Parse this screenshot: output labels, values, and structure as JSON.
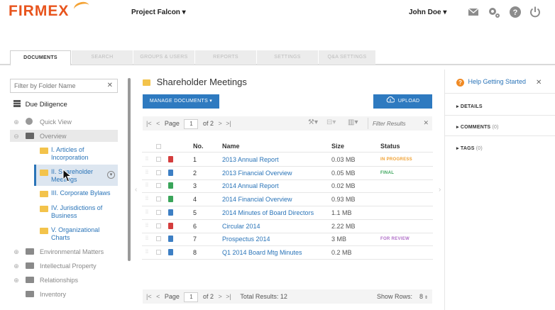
{
  "header": {
    "logo": "FIRMEX",
    "project": "Project Falcon ▾",
    "user": "John Doe ▾"
  },
  "tabs": [
    {
      "label": "DOCUMENTS",
      "active": true
    },
    {
      "label": "SEARCH"
    },
    {
      "label": "GROUPS & USERS"
    },
    {
      "label": "REPORTS"
    },
    {
      "label": "SETTINGS"
    },
    {
      "label": "Q&A SETTINGS"
    }
  ],
  "sidebar": {
    "filter_placeholder": "Filter by Folder Name",
    "root": "Due Diligence",
    "quick_view": "Quick View",
    "overview": "Overview",
    "subfolders": [
      {
        "label": "I. Articles of Incorporation"
      },
      {
        "label": "II. Shareholder Meetings",
        "selected": true
      },
      {
        "label": "III. Corporate Bylaws"
      },
      {
        "label": "IV. Jurisdictions of Business"
      },
      {
        "label": "V. Organizational Charts"
      }
    ],
    "folders": [
      "Environmental Matters",
      "Intellectual Property",
      "Relationships",
      "Inventory"
    ]
  },
  "main": {
    "folder_title": "Shareholder Meetings",
    "manage_label": "MANAGE DOCUMENTS ▾",
    "upload_label": "UPLOAD",
    "page_label": "Page",
    "page_value": "1",
    "page_of": "of 2",
    "filter_placeholder": "Filter Results",
    "total_results": "Total Results: 12",
    "show_rows_label": "Show Rows:",
    "show_rows_value": "8",
    "columns": {
      "no": "No.",
      "name": "Name",
      "size": "Size",
      "status": "Status"
    },
    "rows": [
      {
        "no": "1",
        "name": "2013 Annual Report",
        "size": "0.03 MB",
        "status": "IN PROGRESS",
        "type": "pdf"
      },
      {
        "no": "2",
        "name": "2013 Financial Overview",
        "size": "0.05 MB",
        "status": "FINAL",
        "type": "doc"
      },
      {
        "no": "3",
        "name": "2014 Annual Report",
        "size": "0.02 MB",
        "status": "",
        "type": "xls"
      },
      {
        "no": "4",
        "name": "2014 Financial Overview",
        "size": "0.93 MB",
        "status": "",
        "type": "xls"
      },
      {
        "no": "5",
        "name": "2014 Minutes of Board Directors",
        "size": "1.1 MB",
        "status": "",
        "type": "doc"
      },
      {
        "no": "6",
        "name": "Circular 2014",
        "size": "2.22 MB",
        "status": "",
        "type": "pdf"
      },
      {
        "no": "7",
        "name": "Prospectus 2014",
        "size": "3 MB",
        "status": "FOR REVIEW",
        "type": "doc"
      },
      {
        "no": "8",
        "name": "Q1 2014 Board Mtg Minutes",
        "size": "0.2 MB",
        "status": "",
        "type": "doc"
      }
    ]
  },
  "right": {
    "help": "Help Getting Started",
    "details": "DETAILS",
    "comments": "COMMENTS",
    "comments_count": "(0)",
    "tags": "TAGS",
    "tags_count": "(0)"
  },
  "colors": {
    "accent": "#2e7ac0",
    "brand": "#e8541d",
    "in_progress": "#f0a030",
    "final": "#3aa55a",
    "for_review": "#b06fc8"
  }
}
